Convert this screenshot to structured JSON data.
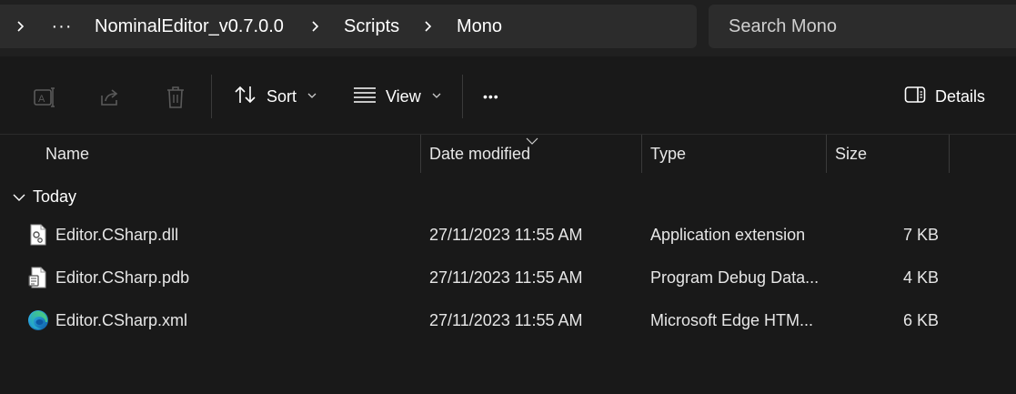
{
  "breadcrumb": {
    "more": "···",
    "items": [
      "NominalEditor_v0.7.0.0",
      "Scripts",
      "Mono"
    ]
  },
  "search": {
    "placeholder": "Search Mono"
  },
  "toolbar": {
    "sort_label": "Sort",
    "view_label": "View",
    "more": "•••",
    "details_label": "Details"
  },
  "columns": {
    "name": "Name",
    "date": "Date modified",
    "type": "Type",
    "size": "Size"
  },
  "group": {
    "label": "Today"
  },
  "files": [
    {
      "name": "Editor.CSharp.dll",
      "date": "27/11/2023 11:55 AM",
      "type": "Application extension",
      "size": "7 KB",
      "icon": "dll-file-icon"
    },
    {
      "name": "Editor.CSharp.pdb",
      "date": "27/11/2023 11:55 AM",
      "type": "Program Debug Data...",
      "size": "4 KB",
      "icon": "pdb-file-icon"
    },
    {
      "name": "Editor.CSharp.xml",
      "date": "27/11/2023 11:55 AM",
      "type": "Microsoft Edge HTM...",
      "size": "6 KB",
      "icon": "edge-icon"
    }
  ],
  "colors": {
    "background": "#191919",
    "bar": "#202020",
    "field": "#2c2c2c",
    "accent": "#4cc2ff"
  }
}
